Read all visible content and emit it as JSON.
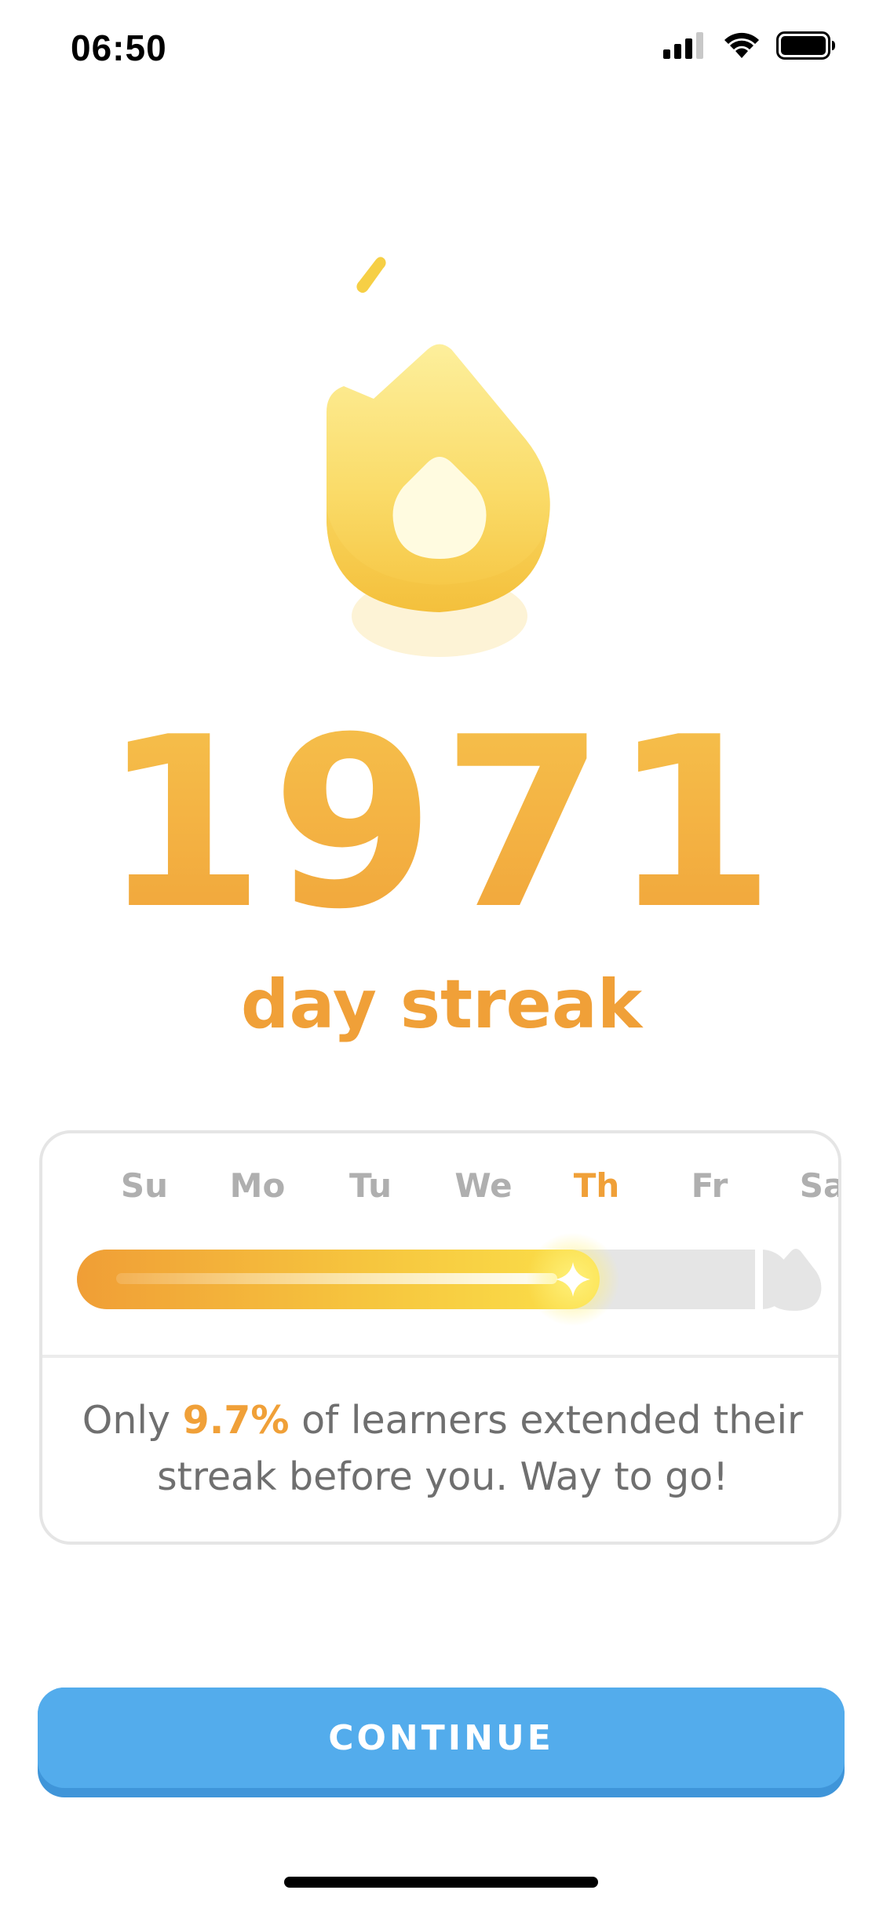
{
  "status_bar": {
    "time": "06:50",
    "signal_icon": "cellular-signal-icon",
    "wifi_icon": "wifi-icon",
    "battery_icon": "battery-icon"
  },
  "streak": {
    "icon": "flame-icon",
    "count": "1971",
    "label": "day streak"
  },
  "week": {
    "days": [
      {
        "label": "Su",
        "active": false
      },
      {
        "label": "Mo",
        "active": false
      },
      {
        "label": "Tu",
        "active": false
      },
      {
        "label": "We",
        "active": false
      },
      {
        "label": "Th",
        "active": true
      },
      {
        "label": "Fr",
        "active": false
      },
      {
        "label": "Sa",
        "active": false
      }
    ],
    "progress_day_index": 4,
    "progress_fraction": 0.69,
    "message_prefix": "Only ",
    "message_highlight": "9.7%",
    "message_suffix": " of learners extended their streak before you. Way to go!"
  },
  "colors": {
    "accent_orange": "#f0a038",
    "button_blue": "#53acec",
    "button_shadow": "#3f95d9",
    "muted_gray": "#afafaf"
  },
  "actions": {
    "continue_label": "CONTINUE"
  }
}
